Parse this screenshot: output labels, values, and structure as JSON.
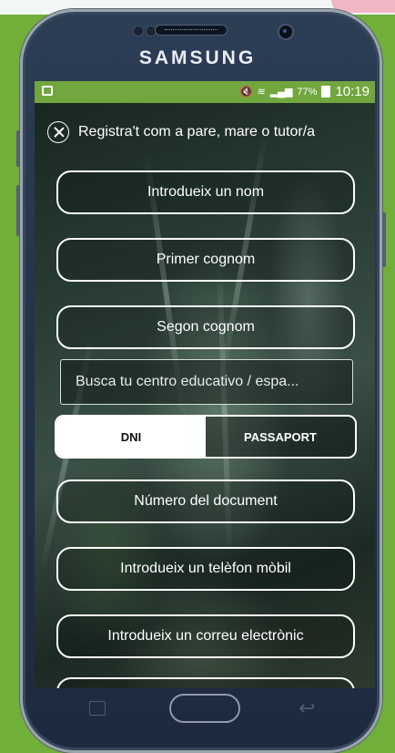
{
  "device": {
    "brand": "SAMSUNG"
  },
  "status_bar": {
    "battery": "77%",
    "time": "10:19"
  },
  "header": {
    "title": "Registra't com a pare, mare o tutor/a"
  },
  "form": {
    "first_name": "Introdueix un nom",
    "first_surname": "Primer cognom",
    "second_surname": "Segon cognom",
    "school_search_placeholder": "Busca tu centro educativo / espa...",
    "doc_type": {
      "options": [
        "DNI",
        "PASSAPORT"
      ],
      "selected": "DNI"
    },
    "document_number": "Número del document",
    "mobile_phone": "Introdueix un telèfon mòbil",
    "email": "Introdueix un correu electrònic"
  },
  "colors": {
    "status_bar": "#72a63f",
    "background": "#6faf3a",
    "toggle_active": "#ffffff"
  }
}
